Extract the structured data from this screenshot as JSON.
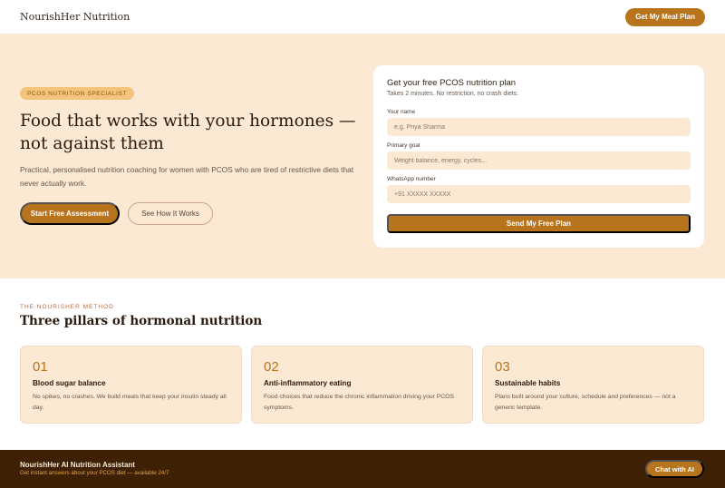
{
  "nav": {
    "brand": "NourishHer Nutrition",
    "cta_label": "Get My Meal Plan"
  },
  "hero": {
    "badge": "PCOS NUTRITION SPECIALIST",
    "headline": "Food that works with your hormones — not against them",
    "description": "Practical, personalised nutrition coaching for women with PCOS who are tired of restrictive diets that never actually work.",
    "primary_cta": "Start Free Assessment",
    "secondary_cta": "See How It Works"
  },
  "form": {
    "title": "Get your free PCOS nutrition plan",
    "subtitle": "Takes 2 minutes. No restriction, no crash diets.",
    "fields": [
      {
        "label": "Your name",
        "placeholder": "e.g. Priya Sharma"
      },
      {
        "label": "Primary goal",
        "placeholder": "Weight balance, energy, cycles..."
      },
      {
        "label": "WhatsApp number",
        "placeholder": "+91 XXXXX XXXXX"
      }
    ],
    "submit_label": "Send My Free Plan"
  },
  "method": {
    "eyebrow": "THE NOURISHER METHOD",
    "title": "Three pillars of hormonal nutrition",
    "pillars": [
      {
        "number": "01",
        "title": "Blood sugar balance",
        "description": "No spikes, no crashes. We build meals that keep your insulin steady all day."
      },
      {
        "number": "02",
        "title": "Anti-inflammatory eating",
        "description": "Food choices that reduce the chronic inflammation driving your PCOS symptoms."
      },
      {
        "number": "03",
        "title": "Sustainable habits",
        "description": "Plans built around your culture, schedule and preferences — not a generic template."
      }
    ]
  },
  "assistant_bar": {
    "title": "NourishHer AI Nutrition Assistant",
    "subtitle": "Get instant answers about your PCOS diet — available 24/7",
    "cta_label": "Chat with AI"
  },
  "colors": {
    "accent": "#b8741c",
    "hero_bg": "#fbe9d4",
    "footer_bg": "#3e2004"
  }
}
